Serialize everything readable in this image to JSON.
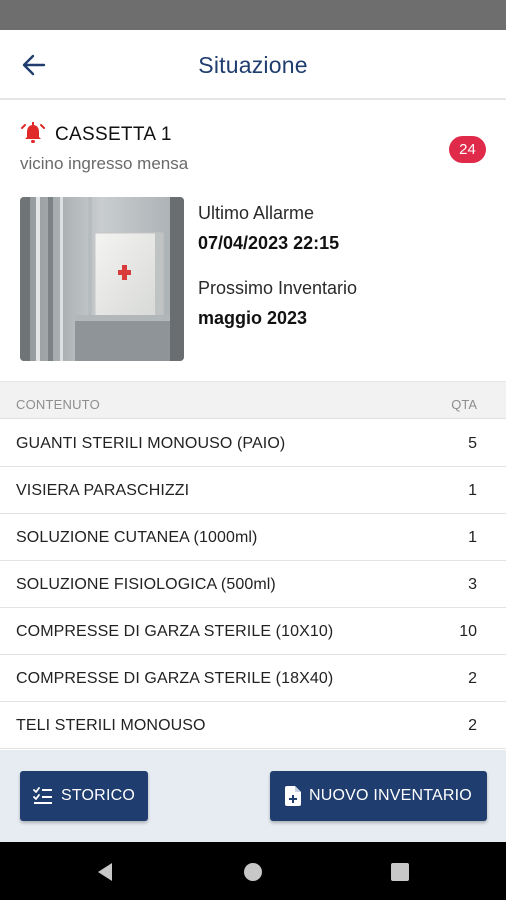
{
  "header": {
    "title": "Situazione"
  },
  "box": {
    "name": "CASSETTA 1",
    "location": "vicino ingresso mensa",
    "badge_count": "24",
    "last_alarm_label": "Ultimo Allarme",
    "last_alarm_value": "07/04/2023 22:15",
    "next_inventory_label": "Prossimo Inventario",
    "next_inventory_value": "maggio 2023"
  },
  "table": {
    "col_content": "CONTENUTO",
    "col_qty": "QTA",
    "rows": [
      {
        "name": "GUANTI STERILI MONOUSO (PAIO)",
        "qty": "5"
      },
      {
        "name": "VISIERA PARASCHIZZI",
        "qty": "1"
      },
      {
        "name": "SOLUZIONE CUTANEA (1000ml)",
        "qty": "1"
      },
      {
        "name": "SOLUZIONE FISIOLOGICA (500ml)",
        "qty": "3"
      },
      {
        "name": "COMPRESSE DI GARZA STERILE (10X10)",
        "qty": "10"
      },
      {
        "name": "COMPRESSE DI GARZA STERILE (18X40)",
        "qty": "2"
      },
      {
        "name": "TELI STERILI MONOUSO",
        "qty": "2"
      }
    ]
  },
  "actions": {
    "history_label": "STORICO",
    "new_inventory_label": "NUOVO INVENTARIO"
  },
  "colors": {
    "primary": "#1f3d6e",
    "alarm": "#e02a2a",
    "badge": "#e02a4a"
  },
  "icons": {
    "back": "arrow-left-icon",
    "alarm": "alarm-bell-icon",
    "history": "checklist-icon",
    "new_inventory": "document-add-icon",
    "nav_back": "triangle-back-icon",
    "nav_home": "circle-home-icon",
    "nav_recents": "square-recents-icon"
  }
}
